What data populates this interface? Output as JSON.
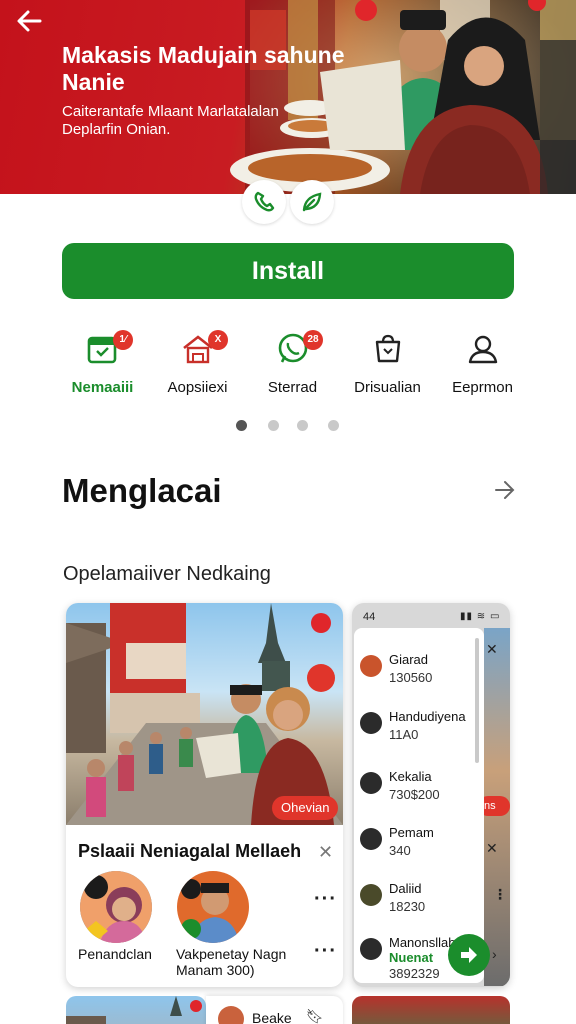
{
  "hero": {
    "title": "Makasis Madujain sahune Nanie",
    "subtitle": "Caiterantafe Mlaant Marlatalalan Deplarfin Onian."
  },
  "install_label": "Install",
  "actions": [
    {
      "label": "Nemaaiii",
      "badge": "1⁄",
      "icon": "calendar-icon",
      "active": true
    },
    {
      "label": "Aopsiiexi",
      "badge": "X",
      "icon": "home-icon",
      "active": false
    },
    {
      "label": "Sterrad",
      "badge": "28",
      "icon": "whatsapp-icon",
      "active": false
    },
    {
      "label": "Drisualian",
      "badge": "",
      "icon": "bag-icon",
      "active": false
    },
    {
      "label": "Eeprmon",
      "badge": "",
      "icon": "person-icon",
      "active": false
    }
  ],
  "section": {
    "title": "Menglacai",
    "subtitle": "Opelamaiiver Nedkaing"
  },
  "card1": {
    "chip": "Ohevian",
    "name": "Pslaaii Neniagalal Mellaeh",
    "person1": "Penandclan",
    "person2": "Vakpenetay Nagn Manam 300)"
  },
  "phone": {
    "status_time": "44",
    "rows": [
      {
        "name": "Giarad",
        "value": "130560"
      },
      {
        "name": "Handudiyena",
        "value": "11A0"
      },
      {
        "name": "Kekalia",
        "value": "730$200"
      },
      {
        "name": "Pemam",
        "value": "340"
      },
      {
        "name": "Daliid",
        "value": "18230"
      },
      {
        "name": "Manonsllab",
        "value": "Nuenat",
        "value2": "3892329"
      }
    ]
  },
  "peek": {
    "label": "Beake"
  },
  "colors": {
    "brand_green": "#1b8d2c",
    "hero_red": "#c4121b",
    "badge_red": "#e0352b"
  }
}
